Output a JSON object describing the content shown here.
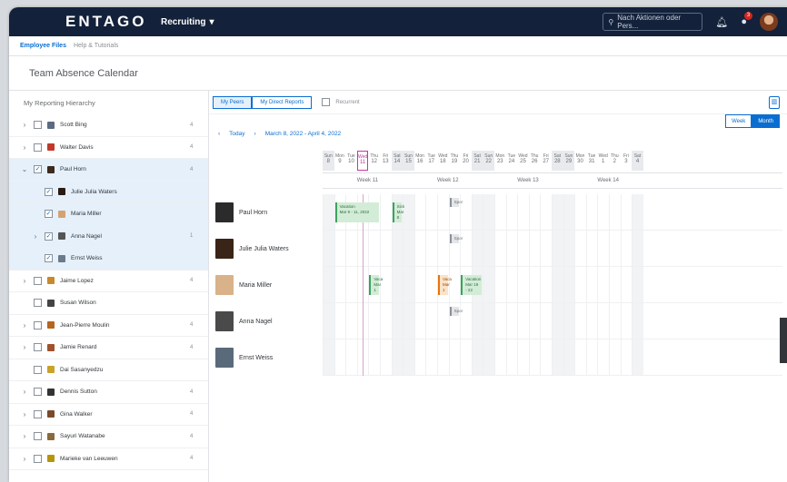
{
  "shell": {
    "logo": "ENTAGO",
    "module": "Recruiting",
    "search_placeholder": "Nach Aktionen oder Pers...",
    "notification_count": "3"
  },
  "subnav": {
    "active": "Employee Files",
    "other": "Help & Tutorials"
  },
  "page_title": "Team Absence Calendar",
  "hierarchy": {
    "header": "My Reporting Hierarchy",
    "rows": [
      {
        "name": "Scott Bing",
        "count": "4",
        "chev": "right",
        "checked": false,
        "indent": 0,
        "sel": false
      },
      {
        "name": "Walter Davis",
        "count": "4",
        "chev": "right",
        "checked": false,
        "indent": 0,
        "sel": false
      },
      {
        "name": "Paul Horn",
        "count": "4",
        "chev": "down",
        "checked": true,
        "indent": 0,
        "sel": true
      },
      {
        "name": "Julie Julia Waters",
        "count": "",
        "chev": "",
        "checked": true,
        "indent": 1,
        "sel": true
      },
      {
        "name": "Maria Miller",
        "count": "",
        "chev": "",
        "checked": true,
        "indent": 1,
        "sel": true
      },
      {
        "name": "Anna Nagel",
        "count": "1",
        "chev": "right",
        "checked": true,
        "indent": 1,
        "sel": true
      },
      {
        "name": "Ernst Weiss",
        "count": "",
        "chev": "",
        "checked": true,
        "indent": 1,
        "sel": true
      },
      {
        "name": "Jaime Lopez",
        "count": "4",
        "chev": "right",
        "checked": false,
        "indent": 0,
        "sel": false
      },
      {
        "name": "Susan Wilson",
        "count": "",
        "chev": "",
        "checked": false,
        "indent": 0,
        "sel": false
      },
      {
        "name": "Jean-Pierre Moulin",
        "count": "4",
        "chev": "right",
        "checked": false,
        "indent": 0,
        "sel": false
      },
      {
        "name": "Jamie Renard",
        "count": "4",
        "chev": "right",
        "checked": false,
        "indent": 0,
        "sel": false
      },
      {
        "name": "Dai Sasanyedzu",
        "count": "",
        "chev": "",
        "checked": false,
        "indent": 0,
        "sel": false
      },
      {
        "name": "Dennis Sutton",
        "count": "4",
        "chev": "right",
        "checked": false,
        "indent": 0,
        "sel": false
      },
      {
        "name": "Gina Walker",
        "count": "4",
        "chev": "right",
        "checked": false,
        "indent": 0,
        "sel": false
      },
      {
        "name": "Sayuri Watanabe",
        "count": "4",
        "chev": "right",
        "checked": false,
        "indent": 0,
        "sel": false
      },
      {
        "name": "Marieke van Leeuwen",
        "count": "4",
        "chev": "right",
        "checked": false,
        "indent": 0,
        "sel": false
      }
    ]
  },
  "toolbar": {
    "peers": "My Peers",
    "direct": "My Direct Reports",
    "recurrent": "Recurrent"
  },
  "views": {
    "week": "Week",
    "month": "Month"
  },
  "date_nav": {
    "today": "Today",
    "range": "March 8, 2022 - April 4, 2022"
  },
  "weeks": [
    "Week 11",
    "Week 12",
    "Week 13",
    "Week 14"
  ],
  "days": [
    {
      "d": "Sun",
      "n": "8",
      "we": true
    },
    {
      "d": "Mon",
      "n": "9"
    },
    {
      "d": "Tue",
      "n": "10"
    },
    {
      "d": "Wed",
      "n": "11",
      "today": true
    },
    {
      "d": "Thu",
      "n": "12"
    },
    {
      "d": "Fri",
      "n": "13"
    },
    {
      "d": "Sat",
      "n": "14",
      "we": true
    },
    {
      "d": "Sun",
      "n": "15",
      "we": true
    },
    {
      "d": "Mon",
      "n": "16"
    },
    {
      "d": "Tue",
      "n": "17"
    },
    {
      "d": "Wed",
      "n": "18"
    },
    {
      "d": "Thu",
      "n": "19"
    },
    {
      "d": "Fri",
      "n": "20"
    },
    {
      "d": "Sat",
      "n": "21",
      "we": true
    },
    {
      "d": "Sun",
      "n": "22",
      "we": true
    },
    {
      "d": "Mon",
      "n": "23"
    },
    {
      "d": "Tue",
      "n": "24"
    },
    {
      "d": "Wed",
      "n": "25"
    },
    {
      "d": "Thu",
      "n": "26"
    },
    {
      "d": "Fri",
      "n": "27"
    },
    {
      "d": "Sat",
      "n": "28",
      "we": true
    },
    {
      "d": "Sun",
      "n": "29",
      "we": true
    },
    {
      "d": "Mon",
      "n": "30"
    },
    {
      "d": "Tue",
      "n": "31"
    },
    {
      "d": "Wed",
      "n": "1"
    },
    {
      "d": "Thu",
      "n": "2"
    },
    {
      "d": "Fri",
      "n": "3"
    },
    {
      "d": "Sat",
      "n": "4",
      "we": true
    }
  ],
  "people": [
    {
      "name": "Paul Horn",
      "events": [
        {
          "start": 1,
          "span": 4,
          "title": "Vacation",
          "sub": "Mar 9 - 11, 2022",
          "color": "green"
        },
        {
          "start": 6,
          "span": 1,
          "title": "Sick",
          "sub": "Mar 8",
          "color": "green"
        },
        {
          "start": 11,
          "span": 1,
          "title": "Spor",
          "sub": "",
          "color": "gray"
        }
      ]
    },
    {
      "name": "Julie Julia Waters",
      "events": [
        {
          "start": 11,
          "span": 1,
          "title": "Spor",
          "sub": "",
          "color": "gray"
        }
      ]
    },
    {
      "name": "Maria Miller",
      "events": [
        {
          "start": 4,
          "span": 1,
          "title": "Vaca",
          "sub": "Mar 1",
          "color": "green"
        },
        {
          "start": 10,
          "span": 1,
          "title": "Vaca",
          "sub": "Mar 1",
          "color": "orange"
        },
        {
          "start": 12,
          "span": 2,
          "title": "Vacation",
          "sub": "Mar 19 - 22",
          "color": "green"
        }
      ]
    },
    {
      "name": "Anna Nagel",
      "events": [
        {
          "start": 11,
          "span": 1,
          "title": "Spor",
          "sub": "",
          "color": "gray"
        }
      ]
    },
    {
      "name": "Ernst Weiss",
      "events": []
    }
  ],
  "colors": {
    "shell": "#13213a",
    "accent": "#0a6ed1",
    "today": "#c0399f"
  }
}
